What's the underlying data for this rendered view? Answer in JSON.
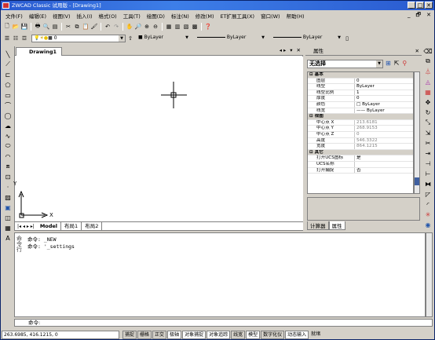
{
  "window": {
    "title": "ZWCAD Classic 试用版 - [Drawing1]",
    "buttons": [
      "_",
      "□",
      "✕"
    ]
  },
  "menu": {
    "items": [
      "文件(F)",
      "编辑(E)",
      "视图(V)",
      "插入(I)",
      "格式(O)",
      "工具(T)",
      "绘图(D)",
      "标注(N)",
      "修改(M)",
      "ET扩展工具(X)",
      "窗口(W)",
      "帮助(H)"
    ],
    "mdi": [
      "_",
      "🗗",
      "✕"
    ]
  },
  "toolbar2": {
    "layer": "0",
    "color": "■ ByLayer",
    "linetype": "ByLayer",
    "lineweight": "ByLayer"
  },
  "document": {
    "tab": "Drawing1",
    "controls": [
      "◂ ▸",
      "▾",
      "✕"
    ]
  },
  "ucs": {
    "y": "Y",
    "x": "X"
  },
  "layouts": {
    "nav": "|◂ ◂ ▸ ▸|",
    "tabs": [
      "Model",
      "布局1",
      "布局2"
    ]
  },
  "properties": {
    "header": "属性",
    "selection": "无选择",
    "tabs": [
      "计算器",
      "属性"
    ],
    "rows": [
      {
        "g": true,
        "k": "⊟ 基本"
      },
      {
        "k": "图层",
        "v": "0"
      },
      {
        "k": "线型",
        "v": "ByLayer"
      },
      {
        "k": "线型比例",
        "v": "1"
      },
      {
        "k": "厚度",
        "v": "0"
      },
      {
        "k": "颜色",
        "v": "□ ByLayer"
      },
      {
        "k": "线宽",
        "v": "—— ByLayer"
      },
      {
        "g": true,
        "k": "⊟ 视图"
      },
      {
        "k": "中心点 X",
        "v": "213.6181",
        "gray": true
      },
      {
        "k": "中心点 Y",
        "v": "268.9153",
        "gray": true
      },
      {
        "k": "中心点 Z",
        "v": "0",
        "gray": true
      },
      {
        "k": "高度",
        "v": "546.3322",
        "gray": true
      },
      {
        "k": "宽度",
        "v": "864.1215",
        "gray": true
      },
      {
        "g": true,
        "k": "⊟ 其它"
      },
      {
        "k": "打开UCS图标",
        "v": "是"
      },
      {
        "k": "UCS名称",
        "v": ""
      },
      {
        "k": "打开捕捉",
        "v": "否"
      }
    ]
  },
  "command": {
    "lines": [
      "命令: _NEW",
      "命令: '_settings"
    ],
    "prompt": "命令:",
    "grip": "命令行"
  },
  "status": {
    "coords": "263.6985,  416.1215,  0",
    "buttons": [
      "捕捉",
      "栅格",
      "正交",
      "极轴",
      "对象捕捉",
      "对象追踪",
      "线宽",
      "模型",
      "数字化仪",
      "动态输入",
      "就绪"
    ]
  }
}
